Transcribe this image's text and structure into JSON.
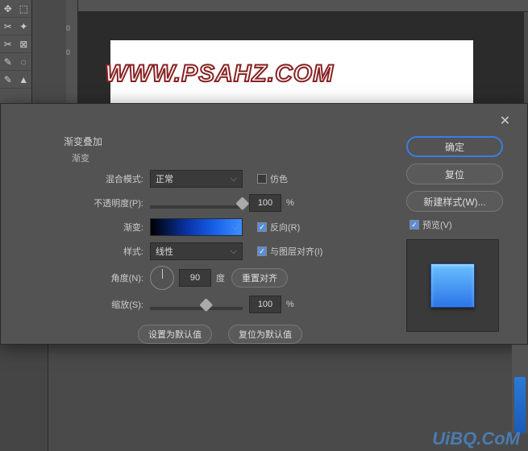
{
  "watermark_top": "WWW.PSAHZ.COM",
  "watermark_bottom": "UiBQ.CoM",
  "dialog": {
    "title": "渐变叠加",
    "subtitle": "渐变",
    "blend_mode_label": "混合模式:",
    "blend_mode_value": "正常",
    "dither_label": "仿色",
    "opacity_label": "不透明度(P):",
    "opacity_value": "100",
    "opacity_unit": "%",
    "gradient_label": "渐变:",
    "reverse_label": "反向(R)",
    "style_label": "样式:",
    "style_value": "线性",
    "align_label": "与图层对齐(I)",
    "angle_label": "角度(N):",
    "angle_value": "90",
    "angle_unit": "度",
    "reset_align": "重置对齐",
    "scale_label": "缩放(S):",
    "scale_value": "100",
    "scale_unit": "%",
    "set_default": "设置为默认值",
    "reset_default": "复位为默认值"
  },
  "buttons": {
    "ok": "确定",
    "cancel": "复位",
    "new_style": "新建样式(W)...",
    "preview": "预览(V)"
  },
  "ruler_v": [
    "0",
    "0"
  ]
}
